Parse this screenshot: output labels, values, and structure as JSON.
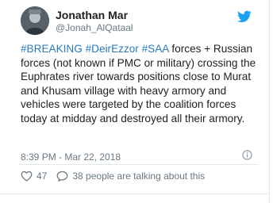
{
  "author": {
    "display_name": "Jonathan Mar",
    "handle": "@Jonah_AlQataal"
  },
  "tweet": {
    "hashtags": [
      "#BREAKING",
      "#DeirEzzor",
      "#SAA"
    ],
    "body_text": "forces + Russian forces (not known if PMC or military) crossing the Euphrates river towards positions close to Murat and Khusam village with heavy armory and vehicles were targeted by the coalition forces today at midday and destroyed all their armory.",
    "timestamp": "8:39 PM - Mar 22, 2018"
  },
  "actions": {
    "like_count": "47",
    "reply_text": "38 people are talking about this"
  },
  "icons": {
    "brand": "twitter-bird-icon",
    "info": "info-icon",
    "like": "heart-icon",
    "reply": "speech-bubble-icon"
  },
  "colors": {
    "link": "#2b7bb9",
    "brand": "#1da1f2",
    "muted": "#697882",
    "text": "#1c2022"
  }
}
